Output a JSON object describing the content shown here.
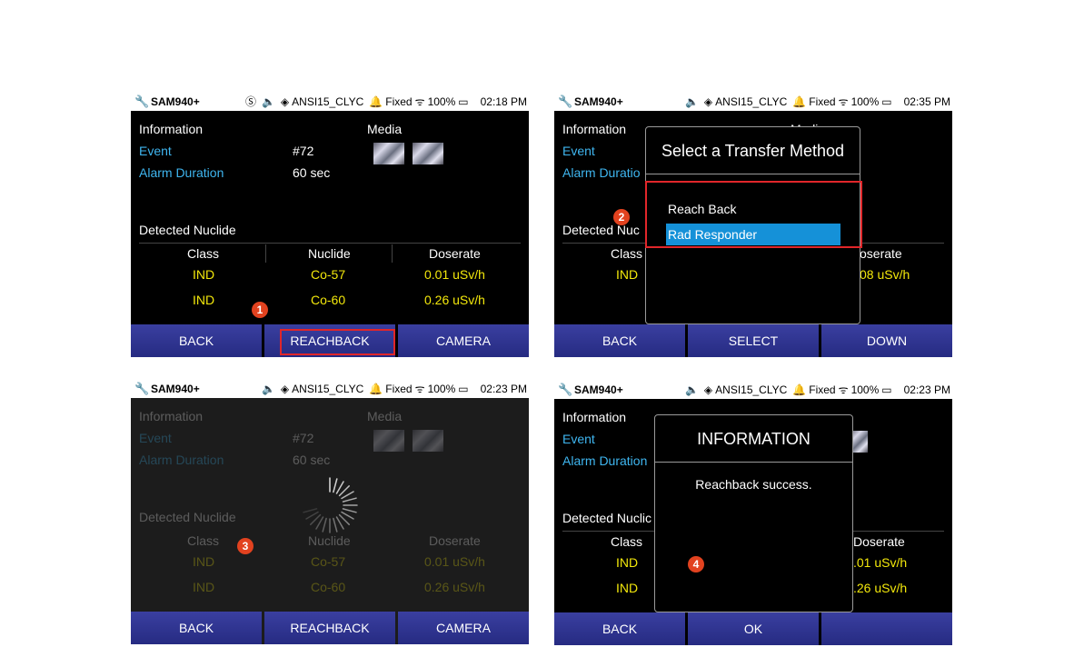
{
  "status": {
    "device": "SAM940+",
    "profile": "ANSI15_CLYC",
    "mode": "Fixed",
    "battery": "100%"
  },
  "screens": [
    {
      "time": "02:18 PM",
      "info_header": "Information",
      "media_header": "Media",
      "event_label": "Event",
      "event_value": "#72",
      "duration_label": "Alarm Duration",
      "duration_value": "60 sec",
      "detected_header": "Detected Nuclide",
      "columns": [
        "Class",
        "Nuclide",
        "Doserate"
      ],
      "rows": [
        {
          "class": "IND",
          "nuclide": "Co-57",
          "doserate": "0.01 uSv/h"
        },
        {
          "class": "IND",
          "nuclide": "Co-60",
          "doserate": "0.26 uSv/h"
        }
      ],
      "softkeys": [
        "BACK",
        "REACHBACK",
        "CAMERA"
      ],
      "badge": "1"
    },
    {
      "time": "02:35 PM",
      "info_header": "Information",
      "media_header_partial": "Media",
      "event_label": "Event",
      "duration_label": "Alarm Duratio",
      "detected_header": "Detected Nuc",
      "class_header": "Class",
      "doserate_header": "oserate",
      "row_class": "IND",
      "row_doserate": "08 uSv/h",
      "dialog_title": "Select a Transfer Method",
      "options": [
        "Reach Back",
        "Rad Responder"
      ],
      "selected_option": "Rad Responder",
      "softkeys": [
        "BACK",
        "SELECT",
        "DOWN"
      ],
      "badge": "2"
    },
    {
      "time": "02:23 PM",
      "info_header": "Information",
      "media_header": "Media",
      "event_label": "Event",
      "event_value": "#72",
      "duration_label": "Alarm Duration",
      "duration_value": "60 sec",
      "detected_header": "Detected Nuclide",
      "columns": [
        "Class",
        "Nuclide",
        "Doserate"
      ],
      "rows": [
        {
          "class": "IND",
          "nuclide": "Co-57",
          "doserate": "0.01 uSv/h"
        },
        {
          "class": "IND",
          "nuclide": "Co-60",
          "doserate": "0.26 uSv/h"
        }
      ],
      "softkeys": [
        "BACK",
        "REACHBACK",
        "CAMERA"
      ],
      "badge": "3"
    },
    {
      "time": "02:23 PM",
      "info_header": "Information",
      "event_label": "Event",
      "duration_label": "Alarm Duration",
      "detected_header": "Detected Nuclic",
      "class_header": "Class",
      "doserate_header": "Doserate",
      "rows": [
        {
          "class": "IND",
          "doserate": ".01 uSv/h"
        },
        {
          "class": "IND",
          "doserate": ".26 uSv/h"
        }
      ],
      "dialog_title": "INFORMATION",
      "dialog_message": "Reachback success.",
      "softkeys": [
        "BACK",
        "OK",
        ""
      ],
      "badge": "4"
    }
  ],
  "colors": {
    "accent_blue": "#3fb6f0",
    "value_yellow": "#f3e80b",
    "softkey": "#2e3390",
    "highlight": "#e1262a",
    "selection": "#1591d8"
  }
}
